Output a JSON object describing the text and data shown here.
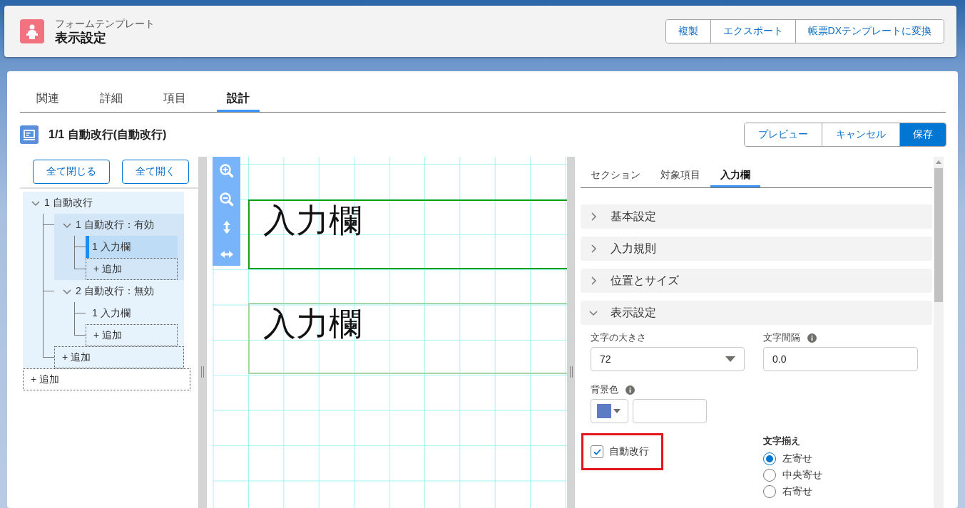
{
  "header": {
    "subtitle": "フォームテンプレート",
    "title": "表示設定",
    "actions": [
      "複製",
      "エクスポート",
      "帳票DXテンプレートに変換"
    ]
  },
  "tabs": [
    {
      "label": "関連",
      "selected": false
    },
    {
      "label": "詳細",
      "selected": false
    },
    {
      "label": "項目",
      "selected": false
    },
    {
      "label": "設計",
      "selected": true
    }
  ],
  "record": {
    "title": "1/1 自動改行(自動改行)",
    "actions": [
      {
        "label": "プレビュー",
        "kind": "default"
      },
      {
        "label": "キャンセル",
        "kind": "default"
      },
      {
        "label": "保存",
        "kind": "brand"
      }
    ]
  },
  "tree": {
    "buttons": [
      "全て閉じる",
      "全て開く"
    ],
    "items": [
      {
        "kind": "node",
        "label": "1 自動改行",
        "expanded": true,
        "active": true,
        "children": [
          {
            "kind": "node",
            "label": "1 自動改行：有効",
            "expanded": true,
            "active": true,
            "children": [
              {
                "kind": "leaf",
                "label": "1 入力欄",
                "selected": true
              },
              {
                "kind": "add",
                "label": "+ 追加"
              }
            ]
          },
          {
            "kind": "node",
            "label": "2 自動改行：無効",
            "expanded": true,
            "active": false,
            "children": [
              {
                "kind": "leaf",
                "label": "1 入力欄",
                "selected": false
              },
              {
                "kind": "add",
                "label": "+ 追加"
              }
            ]
          },
          {
            "kind": "add",
            "label": "+ 追加"
          }
        ]
      },
      {
        "kind": "add",
        "label": "+ 追加"
      }
    ]
  },
  "canvas": {
    "fields": [
      {
        "text": "入力欄",
        "selected": true
      },
      {
        "text": "入力欄",
        "selected": false
      }
    ]
  },
  "properties": {
    "tabs": [
      {
        "label": "セクション",
        "selected": false
      },
      {
        "label": "対象項目",
        "selected": false
      },
      {
        "label": "入力欄",
        "selected": true
      }
    ],
    "sections": [
      {
        "label": "基本設定",
        "expanded": false
      },
      {
        "label": "入力規則",
        "expanded": false
      },
      {
        "label": "位置とサイズ",
        "expanded": false
      },
      {
        "label": "表示設定",
        "expanded": true
      }
    ],
    "fields": [
      {
        "kind": "select",
        "label": "文字の大きさ",
        "value": "72",
        "info": false
      },
      {
        "kind": "text",
        "label": "文字間隔",
        "value": "0.0",
        "info": true
      },
      {
        "kind": "color",
        "label": "背景色",
        "color": "#5b7cc4",
        "info": true
      }
    ],
    "auto_wrap": {
      "label": "自動改行",
      "checked": true,
      "emphasized": true
    },
    "alignment": {
      "label": "文字揃え",
      "options": [
        {
          "label": "左寄せ",
          "selected": true
        },
        {
          "label": "中央寄せ",
          "selected": false
        },
        {
          "label": "右寄せ",
          "selected": false
        }
      ]
    }
  }
}
